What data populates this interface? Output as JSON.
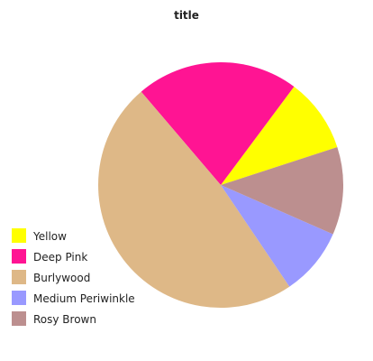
{
  "chart_data": {
    "type": "pie",
    "title": "title",
    "slices": [
      {
        "label": "Yellow",
        "value": 9.4,
        "color": "#ffff00"
      },
      {
        "label": "Deep Pink",
        "value": 20.6,
        "color": "#ff1493"
      },
      {
        "label": "Burlywood",
        "value": 46.3,
        "color": "#deb887"
      },
      {
        "label": "Medium Periwinkle",
        "value": 8.6,
        "color": "#9999ff"
      },
      {
        "label": "Rosy Brown",
        "value": 11.1,
        "color": "#bc8f8f"
      }
    ],
    "legend_placement": "bottom-left"
  }
}
